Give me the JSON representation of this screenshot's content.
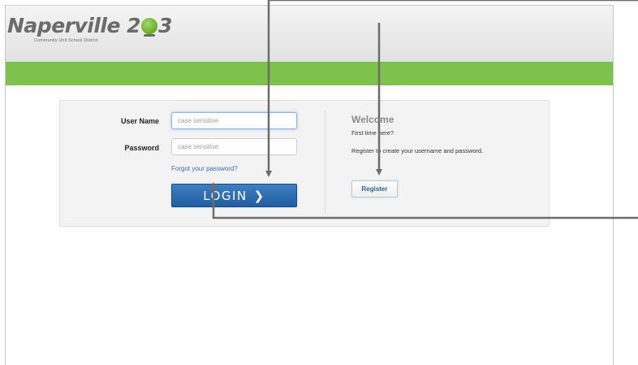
{
  "header": {
    "logo_main_text": "Naperville 2",
    "logo_num_end": "3",
    "logo_subtitle": "Community Unit School District"
  },
  "login": {
    "username_label": "User Name",
    "username_placeholder": "case sensitive",
    "username_value": "",
    "password_label": "Password",
    "password_placeholder": "case sensitive",
    "password_value": "",
    "forgot_link": "Forgot your password?",
    "login_button": "LOGIN"
  },
  "welcome": {
    "title": "Welcome",
    "line1": "First time here?",
    "line2": "Register to create your username and password.",
    "register_button": "Register"
  },
  "colors": {
    "brand_green": "#7dc24b",
    "login_blue": "#2a6cb0",
    "link_blue": "#3a6fb5",
    "annotation_gray": "#6d6d6d"
  },
  "icons": {
    "login_chevron": "chevron-right-icon",
    "logo_globe": "globe-icon"
  }
}
